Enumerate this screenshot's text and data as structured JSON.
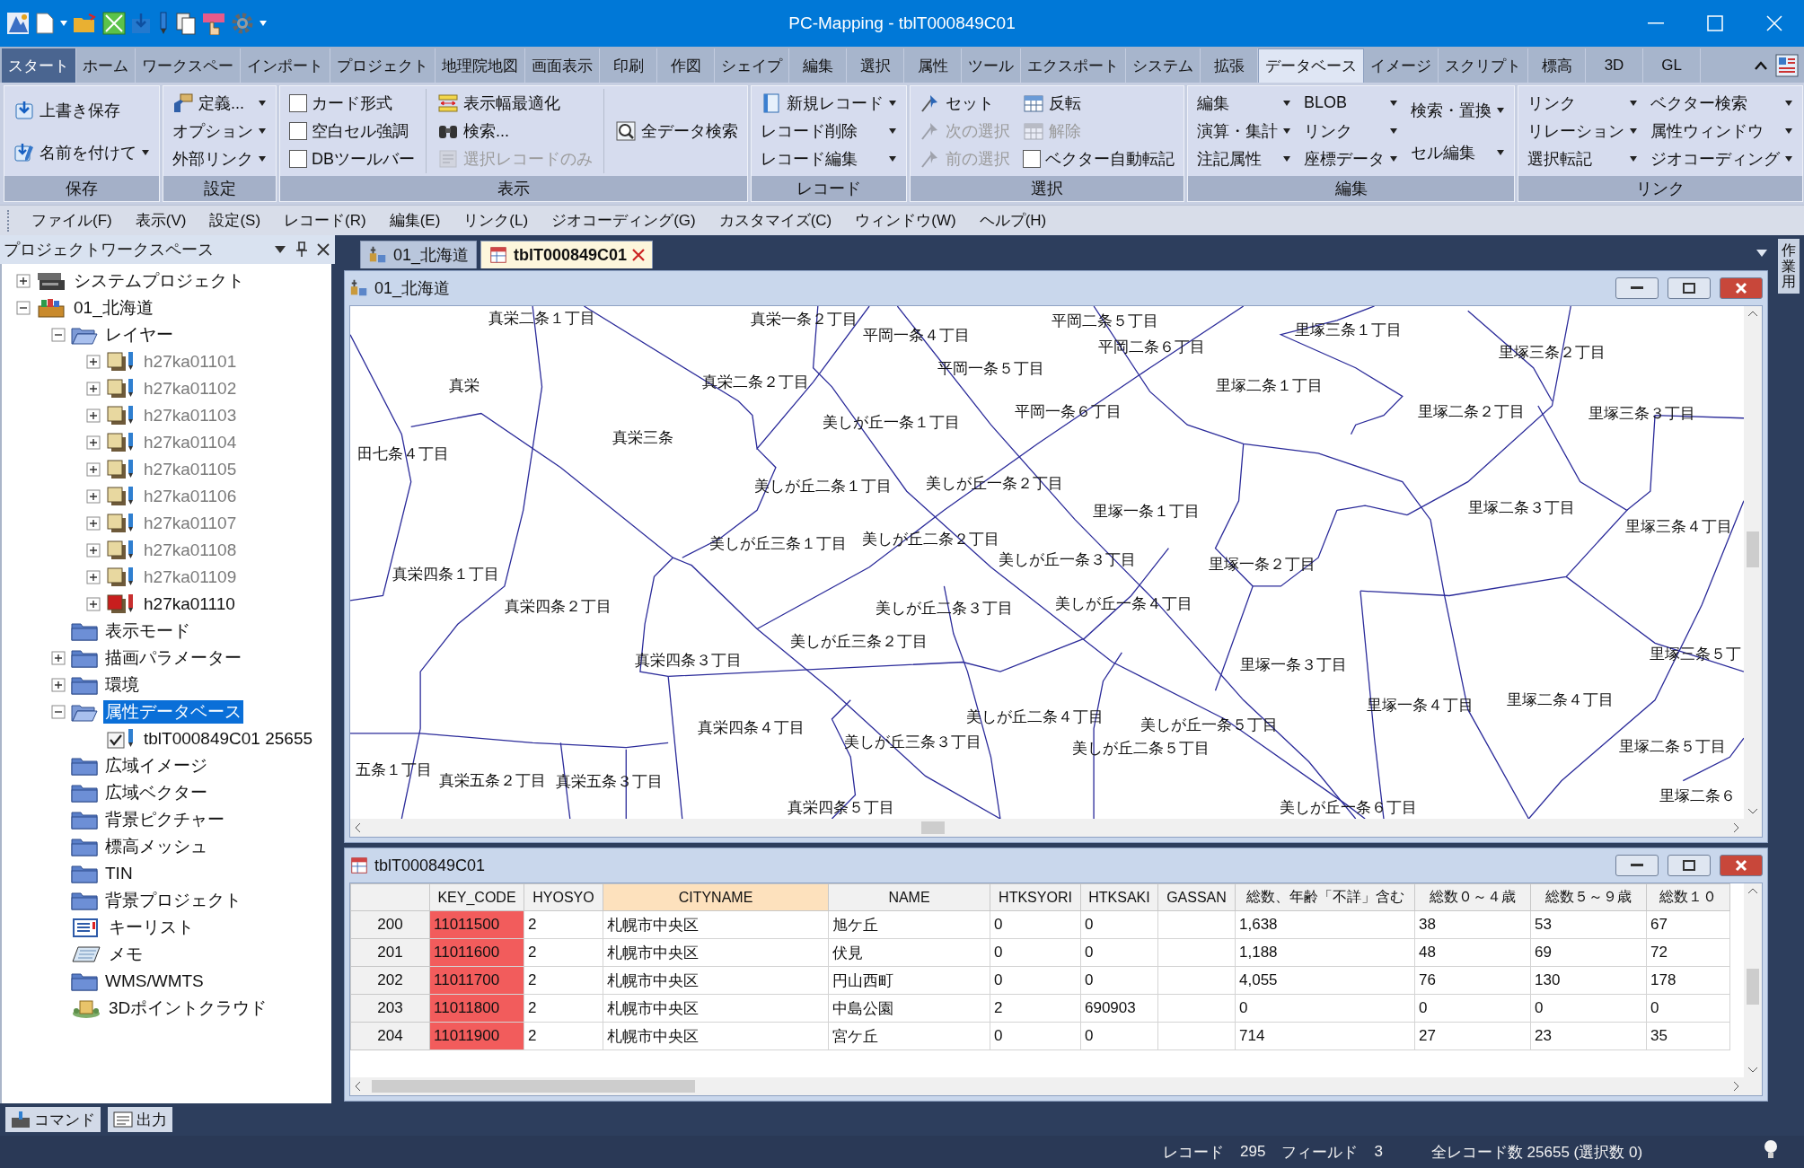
{
  "window": {
    "title": "PC-Mapping - tblT000849C01"
  },
  "ribbon_tabs": [
    {
      "label": "スタート",
      "kind": "app",
      "selected": false
    },
    {
      "label": "ホーム",
      "kind": "tab",
      "selected": false
    },
    {
      "label": "ワークスペー",
      "kind": "tab",
      "selected": false
    },
    {
      "label": "インポート",
      "kind": "tab",
      "selected": false
    },
    {
      "label": "プロジェクト",
      "kind": "tab",
      "selected": false
    },
    {
      "label": "地理院地図",
      "kind": "tab",
      "selected": false
    },
    {
      "label": "画面表示",
      "kind": "tab",
      "selected": false
    },
    {
      "label": "印刷",
      "kind": "tab",
      "selected": false
    },
    {
      "label": "作図",
      "kind": "tab",
      "selected": false
    },
    {
      "label": "シェイプ",
      "kind": "tab",
      "selected": false
    },
    {
      "label": "編集",
      "kind": "tab",
      "selected": false
    },
    {
      "label": "選択",
      "kind": "tab",
      "selected": false
    },
    {
      "label": "属性",
      "kind": "tab",
      "selected": false
    },
    {
      "label": "ツール",
      "kind": "tab",
      "selected": false
    },
    {
      "label": "エクスポート",
      "kind": "tab",
      "selected": false
    },
    {
      "label": "システム",
      "kind": "tab",
      "selected": false
    },
    {
      "label": "拡張",
      "kind": "tab",
      "selected": false
    },
    {
      "label": "データベース",
      "kind": "tab",
      "selected": true
    },
    {
      "label": "イメージ",
      "kind": "tab",
      "selected": false
    },
    {
      "label": "スクリプト",
      "kind": "tab",
      "selected": false
    },
    {
      "label": "標高",
      "kind": "tab",
      "selected": false
    },
    {
      "label": "3D",
      "kind": "tab",
      "selected": false
    },
    {
      "label": "GL",
      "kind": "tab",
      "selected": false
    }
  ],
  "ribbon_groups": [
    {
      "label": "保存",
      "columns": [
        [
          {
            "label": "上書き保存",
            "kind": "icon",
            "disabled": false,
            "dropdown": false
          },
          {
            "label": "名前を付けて",
            "kind": "icon",
            "disabled": false,
            "dropdown": true
          }
        ]
      ]
    },
    {
      "label": "設定",
      "columns": [
        [
          {
            "label": "定義...",
            "kind": "icon",
            "disabled": false,
            "dropdown": true
          },
          {
            "label": "オプション",
            "kind": "text",
            "disabled": false,
            "dropdown": true
          },
          {
            "label": "外部リンク",
            "kind": "text",
            "disabled": false,
            "dropdown": true
          }
        ]
      ]
    },
    {
      "label": "表示",
      "columns": [
        [
          {
            "label": "カード形式",
            "kind": "check",
            "checked": false,
            "disabled": false,
            "dropdown": false
          },
          {
            "label": "空白セル強調",
            "kind": "check",
            "checked": false,
            "disabled": false,
            "dropdown": false
          },
          {
            "label": "DBツールバー",
            "kind": "check",
            "checked": false,
            "disabled": false,
            "dropdown": false
          }
        ],
        [
          {
            "label": "表示幅最適化",
            "kind": "icon",
            "disabled": false,
            "dropdown": false
          },
          {
            "label": "検索...",
            "kind": "icon",
            "disabled": false,
            "dropdown": false
          },
          {
            "label": "選択レコードのみ",
            "kind": "icon",
            "disabled": true,
            "dropdown": false
          }
        ],
        [
          {
            "label": "全データ検索",
            "kind": "icon",
            "disabled": false,
            "dropdown": false
          }
        ]
      ]
    },
    {
      "label": "レコード",
      "columns": [
        [
          {
            "label": "新規レコード",
            "kind": "icon",
            "disabled": false,
            "dropdown": true
          },
          {
            "label": "レコード削除",
            "kind": "text",
            "disabled": false,
            "dropdown": true
          },
          {
            "label": "レコード編集",
            "kind": "text",
            "disabled": false,
            "dropdown": true
          }
        ]
      ]
    },
    {
      "label": "選択",
      "columns": [
        [
          {
            "label": "セット",
            "kind": "icon",
            "disabled": false,
            "dropdown": false
          },
          {
            "label": "次の選択",
            "kind": "icon",
            "disabled": true,
            "dropdown": false
          },
          {
            "label": "前の選択",
            "kind": "icon",
            "disabled": true,
            "dropdown": false
          }
        ],
        [
          {
            "label": "反転",
            "kind": "icon",
            "disabled": false,
            "dropdown": false
          },
          {
            "label": "解除",
            "kind": "icon",
            "disabled": true,
            "dropdown": false
          },
          {
            "label": "ベクター自動転記",
            "kind": "check",
            "checked": false,
            "disabled": false,
            "dropdown": false
          }
        ]
      ]
    },
    {
      "label": "編集",
      "columns": [
        [
          {
            "label": "編集",
            "kind": "text",
            "disabled": false,
            "dropdown": true
          },
          {
            "label": "演算・集計",
            "kind": "text",
            "disabled": false,
            "dropdown": true
          },
          {
            "label": "注記属性",
            "kind": "text",
            "disabled": false,
            "dropdown": true
          }
        ],
        [
          {
            "label": "BLOB",
            "kind": "text",
            "disabled": false,
            "dropdown": true
          },
          {
            "label": "リンク",
            "kind": "text",
            "disabled": false,
            "dropdown": true
          },
          {
            "label": "座標データ",
            "kind": "text",
            "disabled": false,
            "dropdown": true
          }
        ],
        [
          {
            "label": "検索・置換",
            "kind": "text",
            "disabled": false,
            "dropdown": true
          },
          {
            "label": "セル編集",
            "kind": "text",
            "disabled": false,
            "dropdown": true
          }
        ]
      ]
    },
    {
      "label": "リンク",
      "columns": [
        [
          {
            "label": "リンク",
            "kind": "text",
            "disabled": false,
            "dropdown": true
          },
          {
            "label": "リレーション",
            "kind": "text",
            "disabled": false,
            "dropdown": true
          },
          {
            "label": "選択転記",
            "kind": "text",
            "disabled": false,
            "dropdown": true
          }
        ],
        [
          {
            "label": "ベクター検索",
            "kind": "text",
            "disabled": false,
            "dropdown": true
          },
          {
            "label": "属性ウィンドウ",
            "kind": "text",
            "disabled": false,
            "dropdown": true
          },
          {
            "label": "ジオコーディング",
            "kind": "text",
            "disabled": false,
            "dropdown": true
          }
        ]
      ]
    }
  ],
  "menu": [
    "ファイル(F)",
    "表示(V)",
    "設定(S)",
    "レコード(R)",
    "編集(E)",
    "リンク(L)",
    "ジオコーディング(G)",
    "カスタマイズ(C)",
    "ウィンドウ(W)",
    "ヘルプ(H)"
  ],
  "workspace": {
    "title": "プロジェクトワークスペース",
    "tree": [
      {
        "label": "システムプロジェクト",
        "kind": "system-project",
        "expanded": false,
        "selected": false
      },
      {
        "label": "01_北海道",
        "kind": "project",
        "expanded": true,
        "selected": false,
        "children": [
          {
            "label": "レイヤー",
            "kind": "folder",
            "expanded": true,
            "selected": false,
            "children": [
              {
                "label": "h27ka01101",
                "kind": "layer",
                "expanded": false,
                "visible": false,
                "selected": false
              },
              {
                "label": "h27ka01102",
                "kind": "layer",
                "expanded": false,
                "visible": false,
                "selected": false
              },
              {
                "label": "h27ka01103",
                "kind": "layer",
                "expanded": false,
                "visible": false,
                "selected": false
              },
              {
                "label": "h27ka01104",
                "kind": "layer",
                "expanded": false,
                "visible": false,
                "selected": false
              },
              {
                "label": "h27ka01105",
                "kind": "layer",
                "expanded": false,
                "visible": false,
                "selected": false
              },
              {
                "label": "h27ka01106",
                "kind": "layer",
                "expanded": false,
                "visible": false,
                "selected": false
              },
              {
                "label": "h27ka01107",
                "kind": "layer",
                "expanded": false,
                "visible": false,
                "selected": false
              },
              {
                "label": "h27ka01108",
                "kind": "layer",
                "expanded": false,
                "visible": false,
                "selected": false
              },
              {
                "label": "h27ka01109",
                "kind": "layer",
                "expanded": false,
                "visible": false,
                "selected": false
              },
              {
                "label": "h27ka01110",
                "kind": "layer",
                "expanded": false,
                "visible": true,
                "selected": false
              }
            ]
          },
          {
            "label": "表示モード",
            "kind": "folder",
            "selected": false
          },
          {
            "label": "描画パラメーター",
            "kind": "folder",
            "expanded": false,
            "selected": false
          },
          {
            "label": "環境",
            "kind": "folder",
            "expanded": false,
            "selected": false
          },
          {
            "label": "属性データベース",
            "kind": "folder",
            "expanded": true,
            "selected": true,
            "children": [
              {
                "label": "tblT000849C01  25655",
                "kind": "table",
                "checked": true,
                "selected": false
              }
            ]
          },
          {
            "label": "広域イメージ",
            "kind": "folder",
            "selected": false
          },
          {
            "label": "広域ベクター",
            "kind": "folder",
            "selected": false
          },
          {
            "label": "背景ピクチャー",
            "kind": "folder",
            "selected": false
          },
          {
            "label": "標高メッシュ",
            "kind": "folder",
            "selected": false
          },
          {
            "label": "TIN",
            "kind": "folder",
            "selected": false
          },
          {
            "label": "背景プロジェクト",
            "kind": "folder",
            "selected": false
          },
          {
            "label": "キーリスト",
            "kind": "keylist",
            "selected": false
          },
          {
            "label": "メモ",
            "kind": "memo",
            "selected": false
          },
          {
            "label": "WMS/WMTS",
            "kind": "folder",
            "selected": false
          },
          {
            "label": "3Dポイントクラウド",
            "kind": "pointcloud",
            "selected": false
          }
        ]
      }
    ]
  },
  "panel_tabs": [
    {
      "label": "コマンド",
      "kind": "command"
    },
    {
      "label": "出力",
      "kind": "output"
    }
  ],
  "document_tabs": [
    {
      "label": "01_北海道",
      "kind": "map",
      "selected": false
    },
    {
      "label": "tblT000849C01",
      "kind": "table",
      "selected": true
    }
  ],
  "map_window": {
    "title": "01_北海道",
    "labels": [
      "真栄二条１丁目",
      "真栄一条２丁目",
      "平岡一条４丁目",
      "平岡二条５丁目",
      "平岡二条６丁目",
      "里塚三条１丁目",
      "里塚三条２丁目",
      "真栄",
      "真栄二条２丁目",
      "平岡一条５丁目",
      "里塚二条１丁目",
      "平岡一条６丁目",
      "里塚二条２丁目",
      "里塚三条３丁目",
      "美しが丘一条１丁目",
      "真栄三条",
      "田七条４丁目",
      "美しが丘二条１丁目",
      "美しが丘一条２丁目",
      "里塚一条１丁目",
      "里塚二条３丁目",
      "里塚三条４丁目",
      "美しが丘三条１丁目",
      "美しが丘二条２丁目",
      "美しが丘一条３丁目",
      "真栄四条１丁目",
      "里塚一条２丁目",
      "真栄四条２丁目",
      "美しが丘二条３丁目",
      "美しが丘一条４丁目",
      "美しが丘三条２丁目",
      "真栄四条３丁目",
      "里塚一条３丁目",
      "里塚三条５丁",
      "里塚一条４丁目",
      "里塚二条４丁目",
      "真栄四条４丁目",
      "美しが丘三条３丁目",
      "美しが丘二条４丁目",
      "美しが丘二条５丁目",
      "美しが丘一条５丁目",
      "里塚二条５丁目",
      "五条１丁目",
      "真栄五条２丁目",
      "真栄五条３丁目",
      "真栄四条５丁目",
      "美しが丘一条６丁目",
      "里塚二条６"
    ]
  },
  "table_window": {
    "title": "tblT000849C01",
    "columns": [
      {
        "label": "KEY_CODE",
        "selected": false,
        "color": "#f25c5c"
      },
      {
        "label": "HYOSYO",
        "selected": false
      },
      {
        "label": "CITYNAME",
        "selected": true
      },
      {
        "label": "NAME",
        "selected": false
      },
      {
        "label": "HTKSYORI",
        "selected": false
      },
      {
        "label": "HTKSAKI",
        "selected": false
      },
      {
        "label": "GASSAN",
        "selected": false
      },
      {
        "label": "総数、年齢「不詳」含む",
        "selected": false
      },
      {
        "label": "総数０～４歳",
        "selected": false
      },
      {
        "label": "総数５～９歳",
        "selected": false
      },
      {
        "label": "総数１０",
        "selected": false
      }
    ],
    "rows": [
      {
        "header": "200",
        "cells": [
          "11011500",
          "2",
          "札幌市中央区",
          "旭ケ丘",
          "0",
          "0",
          null,
          "1,638",
          "38",
          "53",
          "67"
        ]
      },
      {
        "header": "201",
        "cells": [
          "11011600",
          "2",
          "札幌市中央区",
          "伏見",
          "0",
          "0",
          null,
          "1,188",
          "48",
          "69",
          "72"
        ]
      },
      {
        "header": "202",
        "cells": [
          "11011700",
          "2",
          "札幌市中央区",
          "円山西町",
          "0",
          "0",
          null,
          "4,055",
          "76",
          "130",
          "178"
        ]
      },
      {
        "header": "203",
        "cells": [
          "11011800",
          "2",
          "札幌市中央区",
          "中島公園",
          "2",
          "690903",
          null,
          "0",
          "0",
          "0",
          "0"
        ]
      },
      {
        "header": "204",
        "cells": [
          "11011900",
          "2",
          "札幌市中央区",
          "宮ケ丘",
          "0",
          "0",
          null,
          "714",
          "27",
          "23",
          "35"
        ]
      }
    ]
  },
  "side_tab": {
    "label": "作業用"
  },
  "status_bar": [
    "レコード",
    "295",
    "フィールド",
    "3",
    "全レコード数 25655 (選択数 0)"
  ]
}
